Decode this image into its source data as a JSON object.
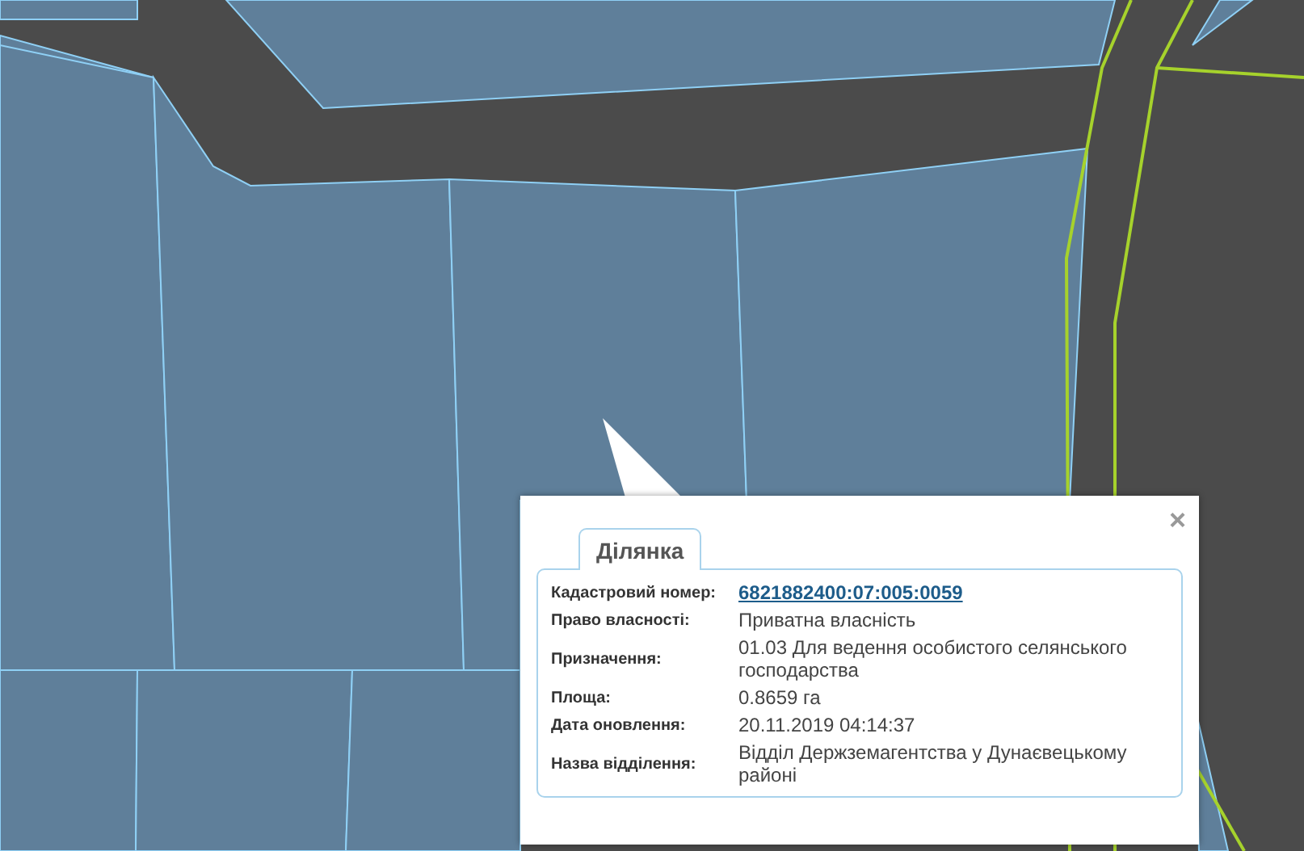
{
  "popup": {
    "close": "×",
    "tabs": [
      {
        "label": "Ділянка",
        "selected": true
      }
    ],
    "fields": [
      {
        "label": "Кадастровий номер:",
        "value": "6821882400:07:005:0059",
        "kind": "link"
      },
      {
        "label": "Право власності:",
        "value": "Приватна власність",
        "kind": "text"
      },
      {
        "label": "Призначення:",
        "value": "01.03 Для ведення особистого селянського господарства",
        "kind": "text"
      },
      {
        "label": "Площа:",
        "value": "0.8659 га",
        "kind": "text"
      },
      {
        "label": "Дата оновлення:",
        "value": "20.11.2019 04:14:37",
        "kind": "text"
      },
      {
        "label": "Назва відділення:",
        "value": "Відділ Держземагентства у Дунаєвецькому районі",
        "kind": "text"
      }
    ]
  }
}
